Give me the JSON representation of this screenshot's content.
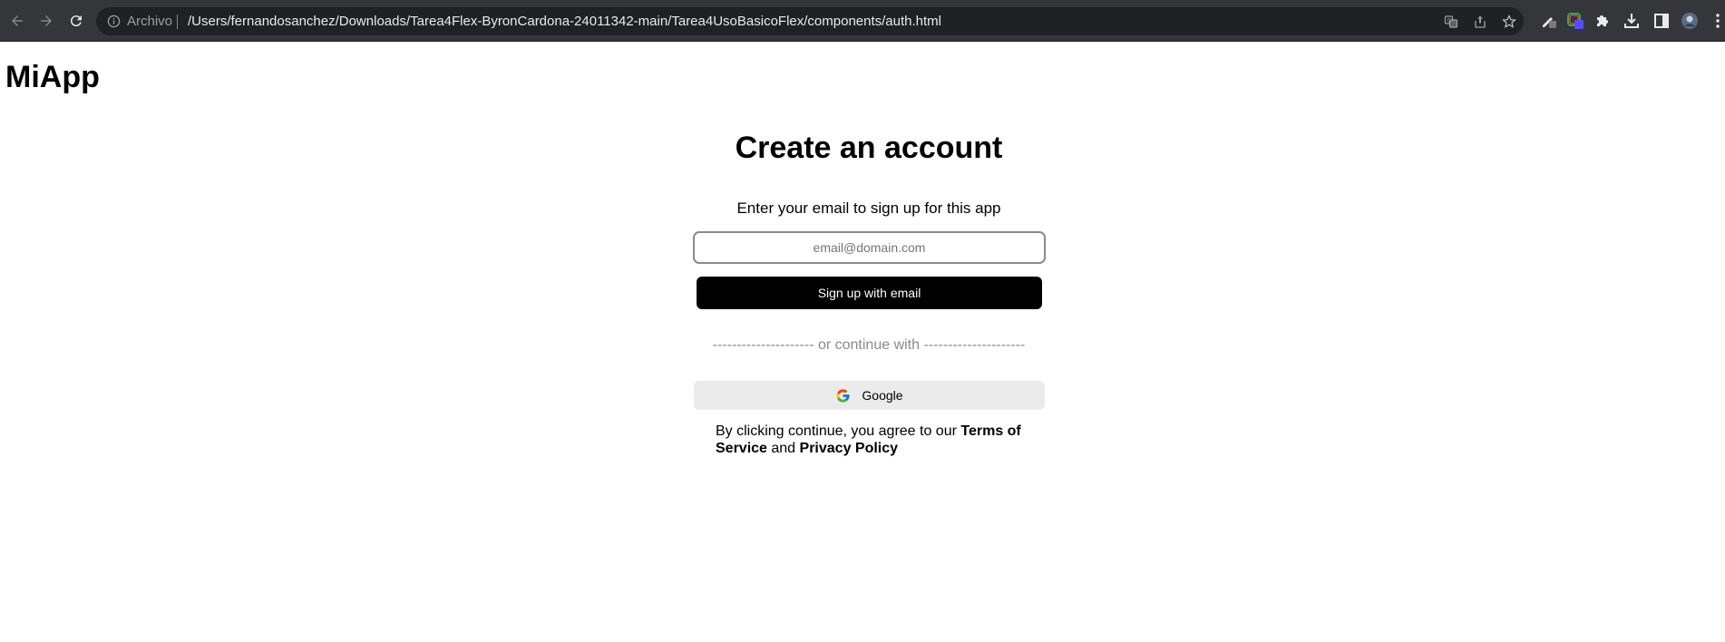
{
  "browser": {
    "scheme_label": "Archivo",
    "url": "/Users/fernandosanchez/Downloads/Tarea4Flex-ByronCardona-24011342-main/Tarea4UsoBasicoFlex/components/auth.html",
    "icons": {
      "back": "arrow-left-icon",
      "forward": "arrow-right-icon",
      "reload": "reload-icon",
      "site_info": "info-icon",
      "translate": "translate-icon",
      "share": "share-icon",
      "bookmark": "star-icon",
      "extensions": [
        "pen-extension-icon",
        "color-extension-icon",
        "puzzle-icon"
      ],
      "download": "download-icon",
      "side_panel": "side-panel-icon",
      "profile": "avatar",
      "menu": "kebab-menu-icon"
    }
  },
  "page": {
    "brand": "MiApp",
    "title": "Create an account",
    "subtitle": "Enter your email to sign up for this app",
    "email": {
      "value": "",
      "placeholder": "email@domain.com"
    },
    "signup_label": "Sign up with email",
    "divider_text": "--------------------- or continue with ---------------------",
    "google_label": "Google",
    "legal": {
      "prefix": "By clicking continue, you agree to our ",
      "terms": "Terms of Service",
      "middle": " and ",
      "privacy": "Privacy Policy"
    }
  },
  "colors": {
    "toolbar_bg": "#35363a",
    "omnibox_bg": "#202124",
    "primary_button": "#000000",
    "secondary_button": "#ebebeb"
  }
}
